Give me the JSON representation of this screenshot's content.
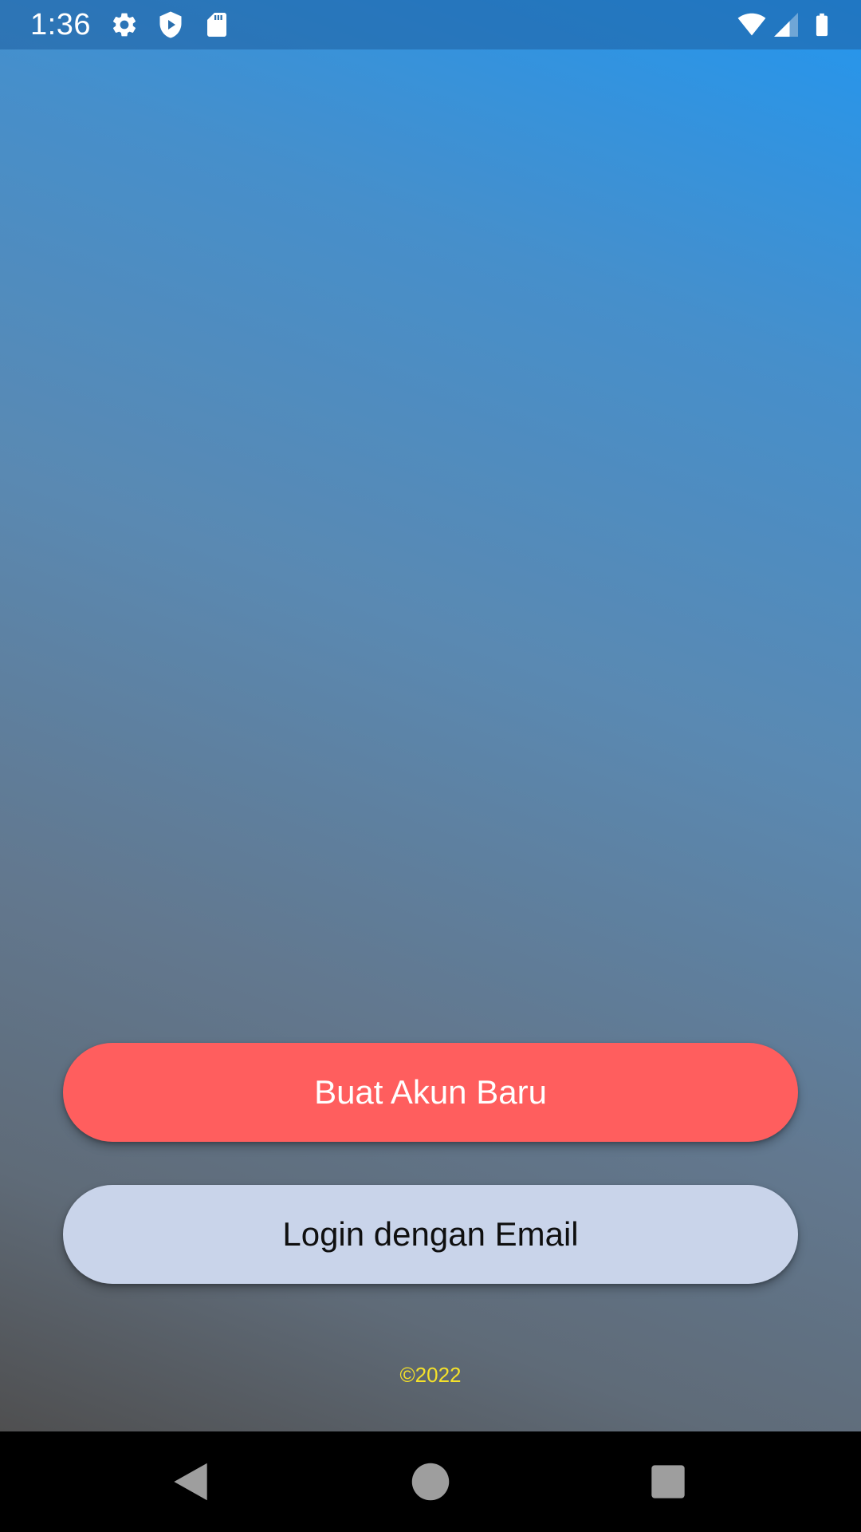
{
  "status_bar": {
    "time": "1:36",
    "left_icons": [
      "gear-icon",
      "shield-play-icon",
      "sd-card-icon"
    ],
    "right_icons": [
      "wifi-icon",
      "cell-signal-icon",
      "battery-icon"
    ]
  },
  "actions": {
    "create_account_label": "Buat Akun Baru",
    "login_email_label": "Login dengan Email"
  },
  "footer": {
    "copyright": "©2022"
  },
  "navigation": {
    "icons": [
      "back-icon",
      "home-icon",
      "recents-icon"
    ]
  },
  "colors": {
    "primary_button": "#ff5e5e",
    "secondary_button": "#c9d4ea",
    "copyright_text": "#f4e12a",
    "gradient_top": "#2496ee",
    "gradient_bottom": "#4f4f50"
  }
}
